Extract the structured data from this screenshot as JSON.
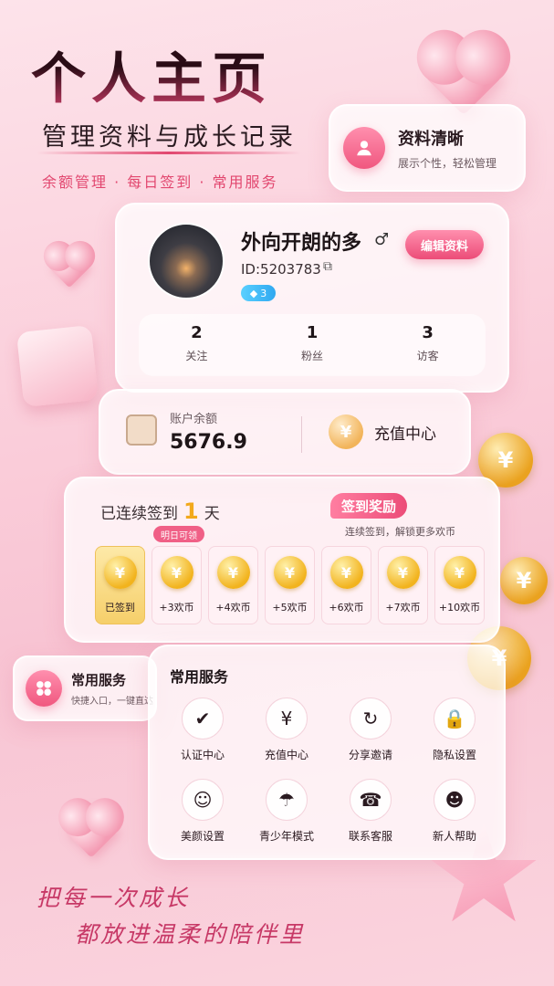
{
  "header": {
    "title": "个人主页",
    "subtitle": "管理资料与成长记录",
    "tags": "余额管理 · 每日签到 · 常用服务"
  },
  "info_chip": {
    "title": "资料清晰",
    "subtitle": "展示个性，轻松管理",
    "icon": "user-icon"
  },
  "profile": {
    "nickname": "外向开朗的多",
    "gender_symbol": "♂",
    "id_text": "ID:5203783",
    "level": "3",
    "edit_label": "编辑资料",
    "stats": [
      {
        "value": "2",
        "label": "关注"
      },
      {
        "value": "1",
        "label": "粉丝"
      },
      {
        "value": "3",
        "label": "访客"
      }
    ]
  },
  "balance": {
    "label": "账户余额",
    "value": "5676.9",
    "recharge_label": "充值中心",
    "coin_symbol": "¥"
  },
  "checkin": {
    "prefix": "已连续签到",
    "days": "1",
    "suffix": "天",
    "reward_title": "签到奖励",
    "reward_sub": "连续签到，解锁更多欢币",
    "tomorrow_tag": "明日可领",
    "items": [
      {
        "label": "已签到",
        "done": true
      },
      {
        "label": "+3欢币",
        "done": false
      },
      {
        "label": "+4欢币",
        "done": false
      },
      {
        "label": "+5欢币",
        "done": false
      },
      {
        "label": "+6欢币",
        "done": false
      },
      {
        "label": "+7欢币",
        "done": false
      },
      {
        "label": "+10欢币",
        "done": false
      }
    ]
  },
  "services_chip": {
    "title": "常用服务",
    "subtitle": "快捷入口，一键直达",
    "icon": "grid-icon"
  },
  "services": {
    "title": "常用服务",
    "items": [
      {
        "label": "认证中心",
        "icon": "shield-check-icon",
        "glyph": "✔"
      },
      {
        "label": "充值中心",
        "icon": "yen-icon",
        "glyph": "¥"
      },
      {
        "label": "分享邀请",
        "icon": "share-icon",
        "glyph": "↻"
      },
      {
        "label": "隐私设置",
        "icon": "lock-icon",
        "glyph": "🔒"
      },
      {
        "label": "美颜设置",
        "icon": "smile-icon",
        "glyph": "☺"
      },
      {
        "label": "青少年模式",
        "icon": "umbrella-icon",
        "glyph": "☂"
      },
      {
        "label": "联系客服",
        "icon": "headset-icon",
        "glyph": "☎"
      },
      {
        "label": "新人帮助",
        "icon": "new-user-icon",
        "glyph": "☻"
      }
    ]
  },
  "slogan": {
    "line1": "把每一次成长",
    "line2": "都放进温柔的陪伴里"
  },
  "colors": {
    "accent": "#ec4c78",
    "gold": "#f2b31d",
    "background": "#fbd0dc"
  }
}
